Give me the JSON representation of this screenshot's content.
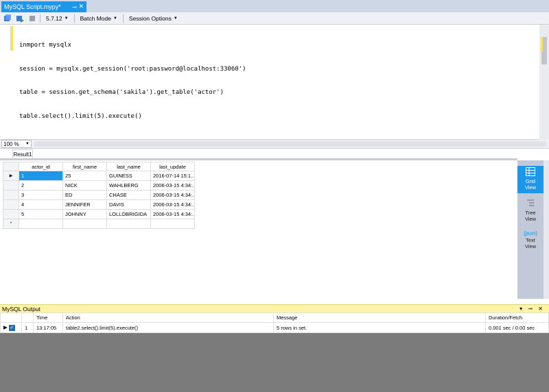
{
  "window": {
    "tab_title": "MySQL Script.mypy*",
    "pin_glyph": "⊸",
    "close_glyph": "✕"
  },
  "toolbar": {
    "version": "5.7.12",
    "mode": "Batch Mode",
    "session_options": "Session Options"
  },
  "editor": {
    "code_lines": [
      "inmport mysqlx",
      "session = mysqlx.get_session('root:password@localhost:33060')",
      "table = session.get_schema('sakila').get_table('actor')",
      "table.select().limit(5).execute()"
    ]
  },
  "zoom": {
    "value": "100 %"
  },
  "results": {
    "tab_label": "Result1",
    "columns": [
      "actor_id",
      "first_name",
      "last_name",
      "last_update"
    ],
    "rows": [
      [
        "1",
        "25",
        "GUINESS",
        "2016-07-14 15:1..."
      ],
      [
        "2",
        "NICK",
        "WAHLBERG",
        "2006-03-15 4:34:..."
      ],
      [
        "3",
        "ED",
        "CHASE",
        "2006-03-15 4:34:..."
      ],
      [
        "4",
        "JENNIFER",
        "DAVIS",
        "2006-03-15 4:34:..."
      ],
      [
        "5",
        "JOHNNY",
        "LOLLOBRIGIDA",
        "2006-03-15 4:34:..."
      ]
    ],
    "new_row_marker": "*",
    "current_row_marker": "▶"
  },
  "views": {
    "grid": [
      "Grid",
      "View"
    ],
    "tree": [
      "Tree",
      "View"
    ],
    "text": [
      "Text",
      "View"
    ],
    "json_icon": "{json}"
  },
  "output": {
    "title": "MySQL Output",
    "controls": "▾ ⊸ ✕",
    "columns": [
      "Time",
      "Action",
      "Message",
      "Duration/Fetch"
    ],
    "rows": [
      {
        "num": "1",
        "time": "13:17:05",
        "action": "table2.select().limit(5).execute()",
        "message": "5 rows in set.",
        "duration": "0.001 sec / 0.00 sec"
      }
    ]
  },
  "colors": {
    "accent": "#1c97ea",
    "output_header": "#fdf3a4",
    "marker": "#f3e45e"
  }
}
